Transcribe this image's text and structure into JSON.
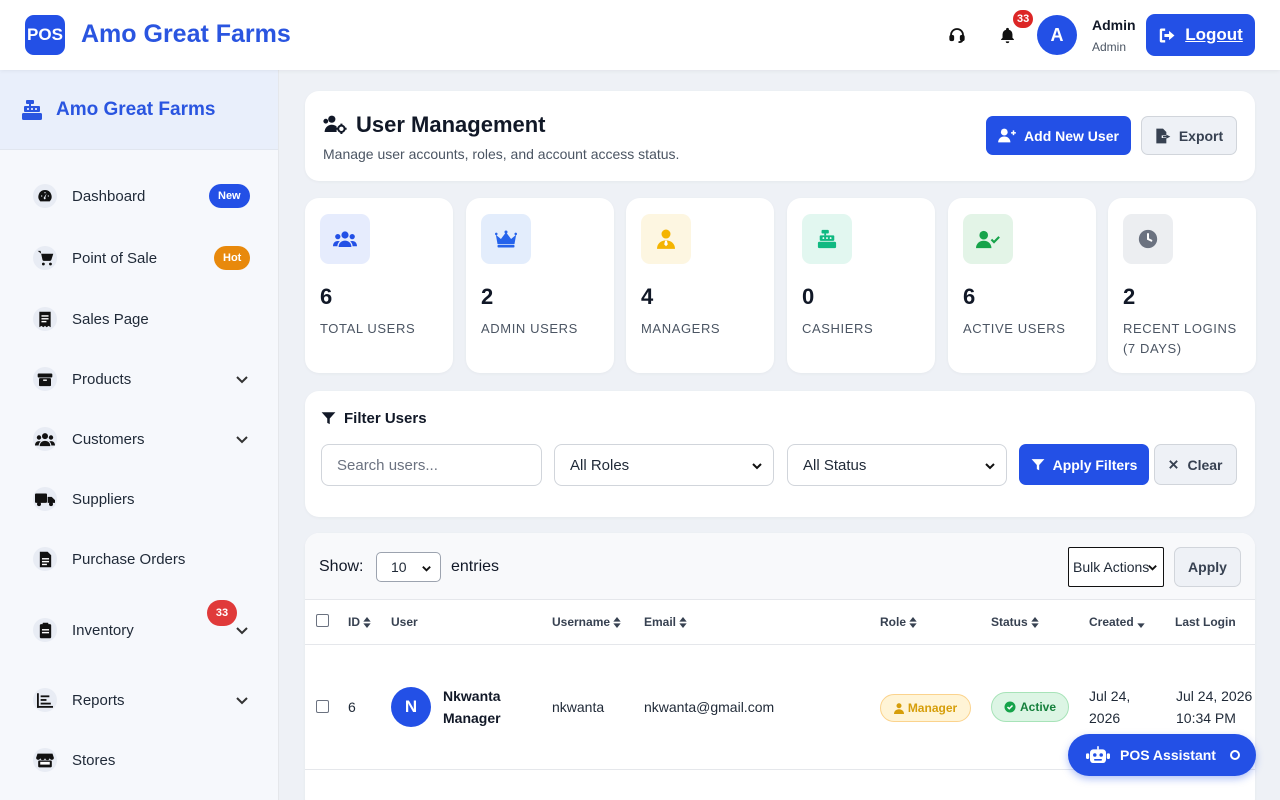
{
  "app": {
    "logo_text": "POS",
    "title": "Amo Great Farms"
  },
  "topbar": {
    "notification_count": "33",
    "avatar_initial": "A",
    "user_name": "Admin",
    "user_role": "Admin",
    "logout_label": "Logout"
  },
  "sidebar": {
    "brand": "Amo Great Farms",
    "items": [
      {
        "label": "Dashboard",
        "icon": "gauge-icon",
        "badge": "New"
      },
      {
        "label": "Point of Sale",
        "icon": "cart-icon",
        "badge": "Hot"
      },
      {
        "label": "Sales Page",
        "icon": "receipt-icon"
      },
      {
        "label": "Products",
        "icon": "box-icon",
        "expandable": true
      },
      {
        "label": "Customers",
        "icon": "users-icon",
        "expandable": true
      },
      {
        "label": "Suppliers",
        "icon": "truck-icon"
      },
      {
        "label": "Purchase Orders",
        "icon": "document-icon"
      },
      {
        "label": "Inventory",
        "icon": "clipboard-icon",
        "badge": "33",
        "expandable": true
      },
      {
        "label": "Reports",
        "icon": "chart-icon",
        "expandable": true
      },
      {
        "label": "Stores",
        "icon": "store-icon"
      }
    ],
    "badge_colors": {
      "new": "#2350e6",
      "hot": "#e8890c",
      "count": "#e03a3a"
    }
  },
  "header": {
    "title": "User Management",
    "subtitle": "Manage user accounts, roles, and account access status.",
    "add_button": "Add New User",
    "export_button": "Export"
  },
  "stats": [
    {
      "value": "6",
      "label": "TOTAL USERS",
      "icon": "users-icon",
      "bg": "#e6ecfd",
      "fg": "#2350e6"
    },
    {
      "value": "2",
      "label": "ADMIN USERS",
      "icon": "crown-icon",
      "bg": "#e3edfc",
      "fg": "#2563eb"
    },
    {
      "value": "4",
      "label": "MANAGERS",
      "icon": "manager-icon",
      "bg": "#fdf6e1",
      "fg": "#f4b400"
    },
    {
      "value": "0",
      "label": "CASHIERS",
      "icon": "cash-register-icon",
      "bg": "#e2f7f0",
      "fg": "#10b981"
    },
    {
      "value": "6",
      "label": "ACTIVE USERS",
      "icon": "user-check-icon",
      "bg": "#e3f4e7",
      "fg": "#16a34a"
    },
    {
      "value": "2",
      "label": "RECENT LOGINS (7 DAYS)",
      "icon": "clock-icon",
      "bg": "#eceef1",
      "fg": "#6b7280"
    }
  ],
  "filters": {
    "title": "Filter Users",
    "search_placeholder": "Search users...",
    "role_select": "All Roles",
    "status_select": "All Status",
    "apply_button": "Apply Filters",
    "clear_button": "Clear"
  },
  "table": {
    "show_label": "Show:",
    "entries_value": "10",
    "entries_label": "entries",
    "bulk_actions": "Bulk Actions",
    "apply_label": "Apply",
    "columns": [
      "ID",
      "User",
      "Username",
      "Email",
      "Role",
      "Status",
      "Created",
      "Last Login"
    ],
    "rows": [
      {
        "id": "6",
        "initial": "N",
        "name_line1": "Nkwanta",
        "name_line2": "Manager",
        "username": "nkwanta",
        "email": "nkwanta@gmail.com",
        "role": "Manager",
        "status": "Active",
        "created_line1": "Jul 24,",
        "created_line2": "2026",
        "last_login_line1": "Jul 24, 2026",
        "last_login_line2": "10:34 PM"
      }
    ]
  },
  "assistant": {
    "label": "POS Assistant"
  },
  "colors": {
    "primary": "#2350e6",
    "brand_text": "#2a55e0",
    "danger": "#dc2626"
  }
}
